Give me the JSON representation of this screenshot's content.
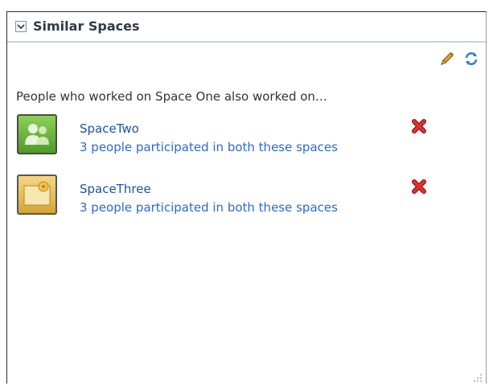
{
  "panel": {
    "title": "Similar Spaces",
    "intro": "People who worked on Space One also worked on…"
  },
  "icons": {
    "collapse": "chevron-down-icon",
    "edit": "pencil-icon",
    "refresh": "refresh-icon",
    "remove": "delete-x-icon",
    "resize": "resize-grip-icon"
  },
  "items": [
    {
      "name": "SpaceTwo",
      "detail": "3 people participated in both these spaces",
      "icon": "group-people-icon"
    },
    {
      "name": "SpaceThree",
      "detail": "3 people participated in both these spaces",
      "icon": "folder-star-icon"
    }
  ],
  "colors": {
    "link": "#2a6ad6",
    "header_rule": "#c9d3df",
    "remove": "#d21f1f"
  }
}
